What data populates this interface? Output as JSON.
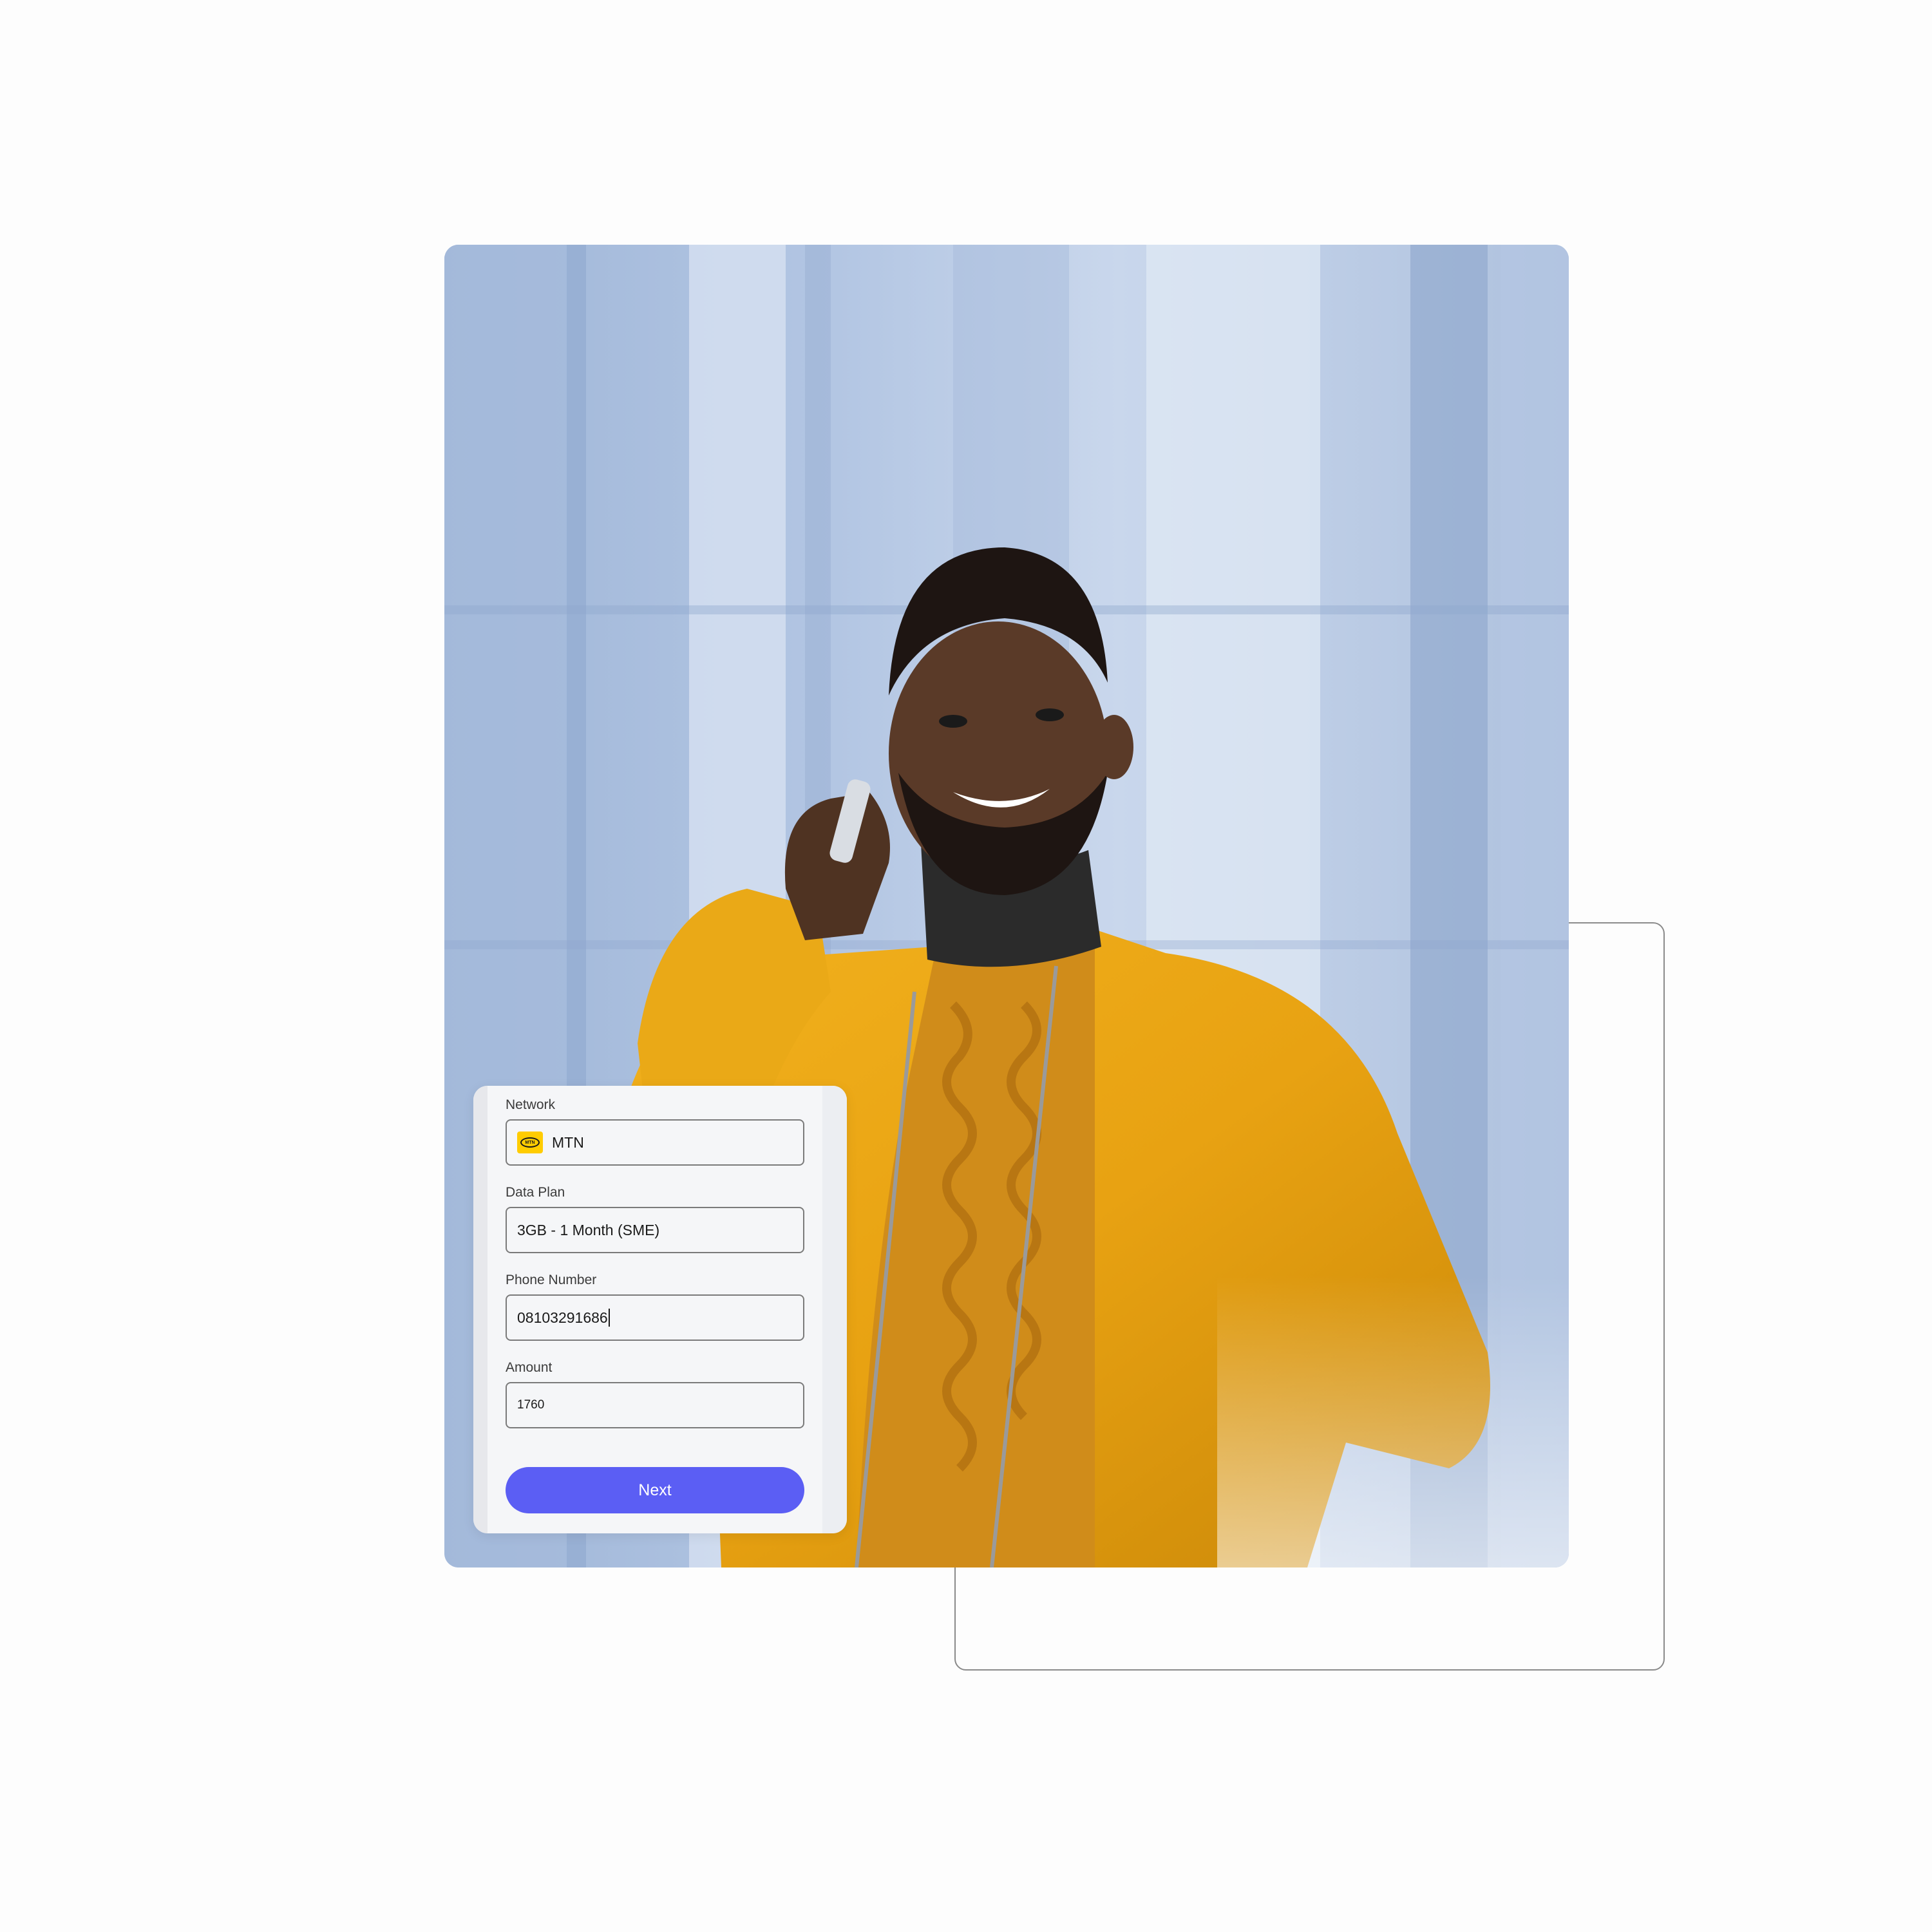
{
  "form": {
    "network": {
      "label": "Network",
      "value": "MTN",
      "logo_text": "MTN",
      "logo_color": "#ffcc00"
    },
    "data_plan": {
      "label": "Data Plan",
      "value": "3GB - 1 Month (SME)"
    },
    "phone_number": {
      "label": "Phone Number",
      "value": "08103291686"
    },
    "amount": {
      "label": "Amount",
      "value": "1760"
    },
    "next_button": {
      "label": "Next",
      "color": "#5b5ef4"
    }
  },
  "photo": {
    "icon": "man-on-phone-photo"
  }
}
